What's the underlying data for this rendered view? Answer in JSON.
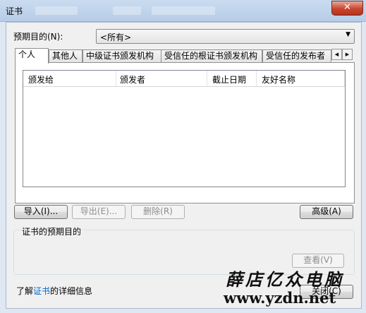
{
  "window": {
    "title": "证书",
    "close_glyph": "✕"
  },
  "purpose": {
    "label": "预期目的(N):",
    "selected": "<所有>"
  },
  "tabs": [
    "个人",
    "其他人",
    "中级证书颁发机构",
    "受信任的根证书颁发机构",
    "受信任的发布者"
  ],
  "tab_scroll": {
    "left": "◀",
    "right": "▶"
  },
  "list": {
    "columns": [
      "颁发给",
      "颁发者",
      "截止日期",
      "友好名称"
    ],
    "rows": []
  },
  "buttons": {
    "import": "导入(I)...",
    "export": "导出(E)...",
    "remove": "删除(R)",
    "advanced": "高级(A)",
    "view": "查看(V)",
    "close": "关闭(C)"
  },
  "group": {
    "title": "证书的预期目的"
  },
  "footer": {
    "prefix": "了解",
    "link": "证书",
    "suffix": "的详细信息"
  },
  "watermark": {
    "line1": "薛店亿众电脑",
    "line2": "www.yzdn.net"
  }
}
